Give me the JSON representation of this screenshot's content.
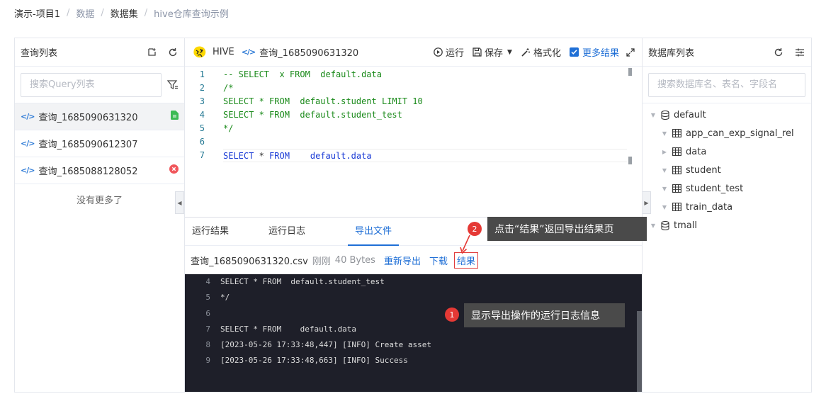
{
  "breadcrumb": [
    "演示-项目1",
    "数据",
    "数据集",
    "hive仓库查询示例"
  ],
  "left_panel": {
    "title": "查询列表",
    "search_placeholder": "搜索Query列表",
    "items": [
      {
        "label": "查询_1685090631320",
        "status": "saved"
      },
      {
        "label": "查询_1685090612307",
        "status": ""
      },
      {
        "label": "查询_1685088128052",
        "status": "error"
      }
    ],
    "no_more": "没有更多了"
  },
  "toolbar": {
    "lang": "HIVE",
    "file": "查询_1685090631320",
    "run": "运行",
    "save": "保存",
    "format": "格式化",
    "more_results": "更多结果"
  },
  "editor": {
    "lines": [
      {
        "no": "1",
        "text": "-- SELECT  x FROM  default.data"
      },
      {
        "no": "2",
        "text": "/*"
      },
      {
        "no": "3",
        "text": "SELECT * FROM  default.student LIMIT 10"
      },
      {
        "no": "4",
        "text": "SELECT * FROM  default.student_test"
      },
      {
        "no": "5",
        "text": "*/"
      },
      {
        "no": "6",
        "text": ""
      },
      {
        "no": "7",
        "kw1": "SELECT",
        "op": " * ",
        "kw2": "FROM",
        "rest": "    default.data"
      }
    ]
  },
  "tabs": [
    "运行结果",
    "运行日志",
    "导出文件"
  ],
  "export": {
    "file": "查询_1685090631320.csv",
    "time": "刚刚",
    "size": "40 Bytes",
    "reexport": "重新导出",
    "download": "下载",
    "result": "结果"
  },
  "log": [
    {
      "no": "4",
      "text": "SELECT * FROM  default.student_test"
    },
    {
      "no": "5",
      "text": "*/"
    },
    {
      "no": "6",
      "text": ""
    },
    {
      "no": "7",
      "text": "SELECT * FROM    default.data"
    },
    {
      "no": "8",
      "text": "[2023-05-26 17:33:48,447] [INFO] Create asset"
    },
    {
      "no": "9",
      "text": "[2023-05-26 17:33:48,663] [INFO] Success"
    }
  ],
  "right_panel": {
    "title": "数据库列表",
    "search_placeholder": "搜索数据库名、表名、字段名",
    "tree": [
      {
        "label": "default",
        "type": "db",
        "expanded": true
      },
      {
        "label": "app_can_exp_signal_rel",
        "type": "table",
        "expanded": true
      },
      {
        "label": "data",
        "type": "table",
        "expanded": false
      },
      {
        "label": "student",
        "type": "table",
        "expanded": true
      },
      {
        "label": "student_test",
        "type": "table",
        "expanded": true
      },
      {
        "label": "train_data",
        "type": "table",
        "expanded": true
      },
      {
        "label": "tmall",
        "type": "db",
        "expanded": true
      }
    ]
  },
  "callouts": [
    {
      "badge": "1",
      "text": "显示导出操作的运行日志信息"
    },
    {
      "badge": "2",
      "text": "点击“结果”返回导出结果页"
    }
  ],
  "colors": {
    "accent": "#1f6fd6",
    "annotation": "#e53935",
    "log_bg": "#1e1f29"
  }
}
